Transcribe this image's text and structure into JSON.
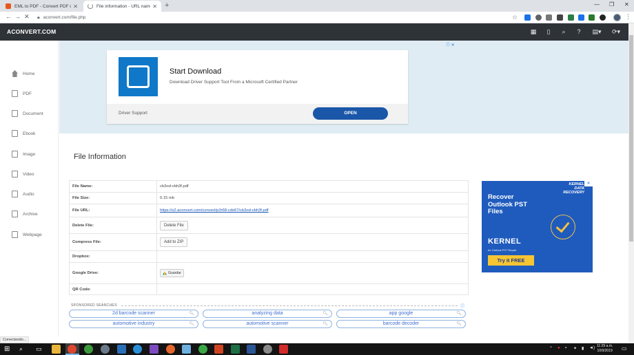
{
  "browser": {
    "tabs": [
      {
        "title": "EML to PDF - Convert PDF online"
      },
      {
        "title": "File information - URL name, siz"
      }
    ],
    "url": "aconvert.com/file.php"
  },
  "site": {
    "logo": "ACONVERT.COM",
    "sidebar": [
      {
        "label": "Home"
      },
      {
        "label": "PDF"
      },
      {
        "label": "Document"
      },
      {
        "label": "Ebook"
      },
      {
        "label": "Image"
      },
      {
        "label": "Video"
      },
      {
        "label": "Audio"
      },
      {
        "label": "Archive"
      },
      {
        "label": "Webpage"
      }
    ]
  },
  "top_ad": {
    "title": "Start Download",
    "subtitle": "Download Driver Support Tool From a Microsoft Certified Partner",
    "brand": "Driver Support",
    "button": "OPEN"
  },
  "main": {
    "title": "File Information",
    "rows": {
      "file_name": {
        "key": "File Name:",
        "value": "cb3od-vbh3f.pdf"
      },
      "file_size": {
        "key": "File Size:",
        "value": "0.15 mb"
      },
      "file_url": {
        "key": "File URL:",
        "value": "https://s2.aconvert.com/convert/p3r68-cdx67/cb3od-vbh3f.pdf"
      },
      "delete_file": {
        "key": "Delete File:",
        "button": "Delete File"
      },
      "compress_file": {
        "key": "Compress File:",
        "button": "Add to ZIP"
      },
      "dropbox": {
        "key": "Dropbox:"
      },
      "google_drive": {
        "key": "Google Drive:",
        "button": "Guardar"
      },
      "qr_code": {
        "key": "QR Code:"
      }
    }
  },
  "sponsored": {
    "label": "SPONSORED SEARCHES",
    "items": [
      "2d barcode scanner",
      "analyzing data",
      "app google",
      "automotive industry",
      "automotive scanner",
      "barcode decoder"
    ]
  },
  "right_ad": {
    "brand": "KERNEL DATA RECOVERY",
    "headline": "Recover Outlook PST Files",
    "logo": "KERNEL",
    "tagline": "for Outlook PST Repair",
    "cta": "Try it FREE"
  },
  "status": "Conectando...",
  "taskbar": {
    "time": "11:29 a.m.",
    "date": "10/9/2019"
  }
}
